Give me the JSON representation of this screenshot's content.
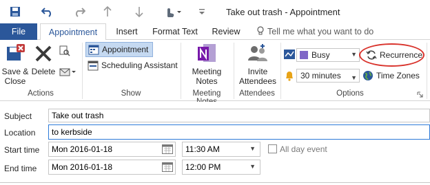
{
  "window": {
    "title": "Take out trash - Appointment"
  },
  "qat": {
    "icons": [
      "save-icon",
      "undo-icon",
      "redo-icon",
      "up-arrow-icon",
      "down-arrow-icon",
      "touch-mode-icon",
      "customize-qat-icon"
    ]
  },
  "tabs": [
    {
      "label": "File"
    },
    {
      "label": "Appointment"
    },
    {
      "label": "Insert"
    },
    {
      "label": "Format Text"
    },
    {
      "label": "Review"
    }
  ],
  "tell_me": "Tell me what you want to do",
  "ribbon": {
    "actions": {
      "group": "Actions",
      "save_close": [
        "Save &",
        "Close"
      ],
      "delete": "Delete"
    },
    "show": {
      "group": "Show",
      "appointment": "Appointment",
      "scheduling": "Scheduling Assistant"
    },
    "meeting_notes": {
      "group": "Meeting Notes",
      "button": [
        "Meeting",
        "Notes"
      ]
    },
    "attendees": {
      "group": "Attendees",
      "button": [
        "Invite",
        "Attendees"
      ]
    },
    "options": {
      "group": "Options",
      "show_as": "Busy",
      "reminder": "30 minutes",
      "recurrence": "Recurrence",
      "time_zones": "Time Zones",
      "busy_color": "#8067c7"
    }
  },
  "form": {
    "subject_label": "Subject",
    "subject_value": "Take out trash",
    "location_label": "Location",
    "location_value": "to kerbside",
    "start_label": "Start time",
    "start_date": "Mon 2016-01-18",
    "start_time": "11:30 AM",
    "all_day_label": "All day event",
    "end_label": "End time",
    "end_date": "Mon 2016-01-18",
    "end_time": "12:00 PM"
  },
  "colors": {
    "accent": "#2b579a",
    "highlight": "#d9332c"
  }
}
